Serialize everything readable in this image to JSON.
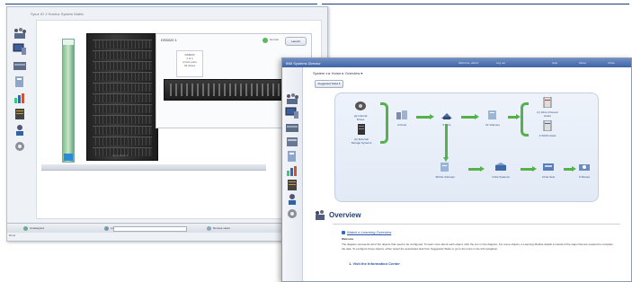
{
  "window1": {
    "breadcrumb": "Sys ▸ ID 1 Hosts ▸ System Matrix",
    "rack_label": "Sys ▸ Rack 1",
    "detail": {
      "title": "DS5020 1",
      "status": "Normal",
      "action_button": "Launch",
      "info_card": [
        "DS5020",
        "1 of 1",
        "4 host ports",
        "32 drives"
      ]
    },
    "bottom_bar": {
      "item1": "Unassigned",
      "item2": "Locate",
      "item3": "Remote views"
    },
    "status_line": "Done"
  },
  "window2": {
    "app_title": "IBM Systems Director",
    "menu": [
      "Welcome, admin",
      "Log out",
      "Help",
      "About",
      "Close"
    ],
    "breadcrumb": "System x ▸ Home ▸ Overview ▾",
    "suggested_button": "Suggested Tasks ▾",
    "flow": {
      "n1": "(a) Internal\nDrives",
      "n2": "(b) External\nStorage Systems",
      "n3": "2 Pools",
      "n4": "5 Tiers",
      "n5": "21 Volumes",
      "n6": "(c) Fibre Channel\nHosts",
      "n7": "3 iSCSI Hosts",
      "n8": "38 File Volumes",
      "n9": "4 File Systems",
      "n10": "3 File Sets",
      "n11": "6 Shares"
    },
    "overview": {
      "heading": "Overview",
      "link1": "Watch e-Learning Overview",
      "subhead": "Welcome",
      "paragraph": "The diagram represents all of the objects that need to be configured. To learn more about each object, click the icon in the diagram. For some objects, a Learning Module details a tutorial of the steps that are required to complete the task. To configure those objects, either select the associated task from Suggested Tasks or go to the icons in the left navigation.",
      "link2": "1. Visit the Information Center"
    }
  }
}
